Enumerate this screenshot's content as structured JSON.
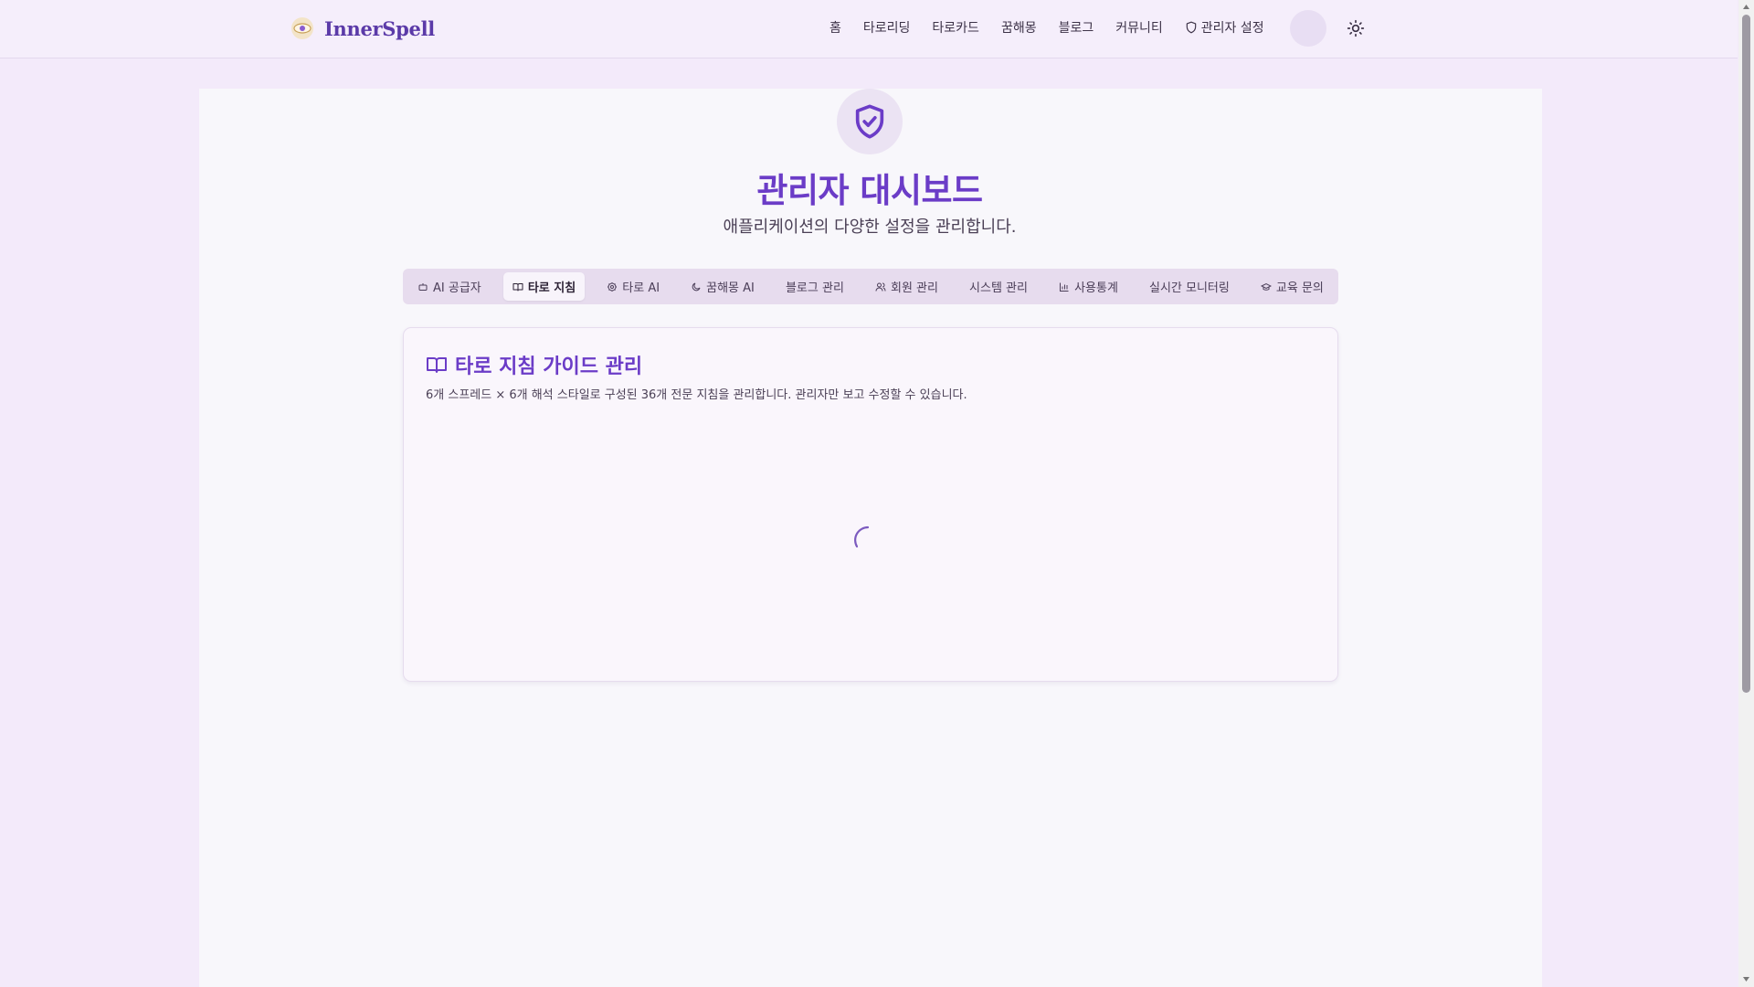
{
  "header": {
    "logo_text": "InnerSpell",
    "nav": [
      {
        "label": "홈"
      },
      {
        "label": "타로리딩"
      },
      {
        "label": "타로카드"
      },
      {
        "label": "꿈해몽"
      },
      {
        "label": "블로그"
      },
      {
        "label": "커뮤니티"
      },
      {
        "label": "관리자 설정",
        "icon": "shield-icon"
      }
    ],
    "theme_icon": "sun-icon"
  },
  "page": {
    "title": "관리자 대시보드",
    "subtitle": "애플리케이션의 다양한 설정을 관리합니다.",
    "header_icon": "shield-check-icon"
  },
  "tabs": [
    {
      "label": "AI 공급자",
      "icon": "bot-icon"
    },
    {
      "label": "타로 지침",
      "icon": "book-open-icon",
      "active": true
    },
    {
      "label": "타로 AI",
      "icon": "gear-icon"
    },
    {
      "label": "꿈해몽 AI",
      "icon": "moon-icon"
    },
    {
      "label": "블로그 관리"
    },
    {
      "label": "회원 관리",
      "icon": "users-icon"
    },
    {
      "label": "시스템 관리"
    },
    {
      "label": "사용통계",
      "icon": "bar-chart-icon"
    },
    {
      "label": "실시간 모니터링"
    },
    {
      "label": "교육 문의",
      "icon": "graduation-cap-icon"
    }
  ],
  "card": {
    "title": "타로 지침 가이드 관리",
    "description": "6개 스프레드 × 6개 해석 스타일로 구성된 36개 전문 지침을 관리합니다. 관리자만 보고 수정할 수 있습니다.",
    "state": "loading"
  },
  "colors": {
    "accent": "#6b3cc7",
    "background": "#f3eafa",
    "panel": "#f8f7fb"
  }
}
